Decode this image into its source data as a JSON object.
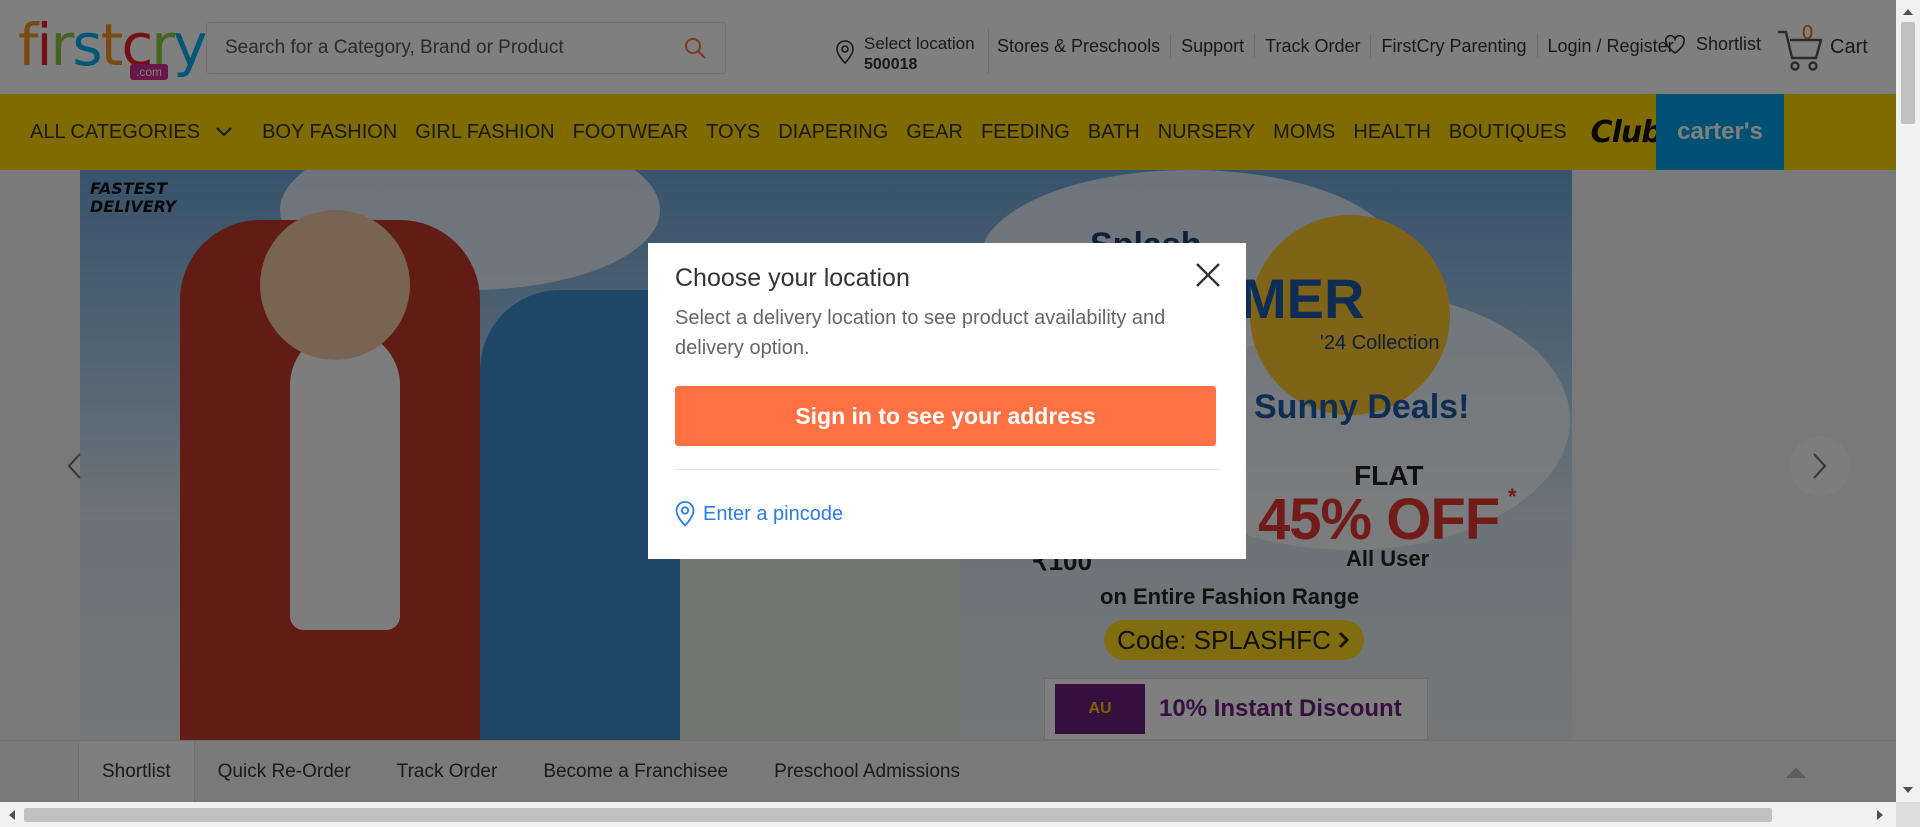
{
  "header": {
    "logo_letters": [
      "f",
      "i",
      "r",
      "s",
      "t",
      "c",
      "r",
      "y"
    ],
    "logo_colors": [
      "#f7941d",
      "#ed1c24",
      "#8dc63f",
      "#00aeef",
      "#f7941d",
      "#ed1c24",
      "#8dc63f",
      "#00aeef"
    ],
    "logo_suffix": ".com",
    "search_placeholder": "Search for a Category, Brand or Product",
    "location_label": "Select location",
    "location_pincode": "500018",
    "links": [
      "Stores & Preschools",
      "Support",
      "Track Order",
      "FirstCry Parenting",
      "Login / Register"
    ],
    "shortlist_label": "Shortlist",
    "cart_count": "0",
    "cart_label": "Cart"
  },
  "nav": {
    "all_categories": "ALL CATEGORIES",
    "items": [
      "BOY FASHION",
      "GIRL FASHION",
      "FOOTWEAR",
      "TOYS",
      "DIAPERING",
      "GEAR",
      "FEEDING",
      "BATH",
      "NURSERY",
      "MOMS",
      "HEALTH",
      "BOUTIQUES"
    ],
    "club": "Club",
    "carters": "carter's"
  },
  "banner": {
    "fast_delivery_line1": "FASTEST",
    "fast_delivery_line2": "DELIVERY",
    "splash_partial": "Splash",
    "summer_partial": "MER",
    "collection": "'24 Collection",
    "sunny_deals": "Sunny Deals!",
    "flat": "FLAT",
    "off": "45% OFF",
    "asterisk": "*",
    "all_user": "All User",
    "price_partial": "₹100",
    "range": "on Entire Fashion Range",
    "code": "Code: SPLASHFC",
    "au_logo": "AU",
    "instant_discount": "10% Instant Discount"
  },
  "bottom_bar": {
    "tabs": [
      "Shortlist",
      "Quick Re-Order",
      "Track Order",
      "Become a Franchisee",
      "Preschool Admissions"
    ]
  },
  "modal": {
    "title": "Choose your location",
    "description": "Select a delivery location to see product availability and delivery option.",
    "signin_button": "Sign in to see your address",
    "pincode_link": "Enter a pincode"
  },
  "colors": {
    "nav_bg": "#ffd700",
    "primary_cta": "#ff7043",
    "link_blue": "#2a7de1",
    "carters_blue": "#00a0e9"
  }
}
